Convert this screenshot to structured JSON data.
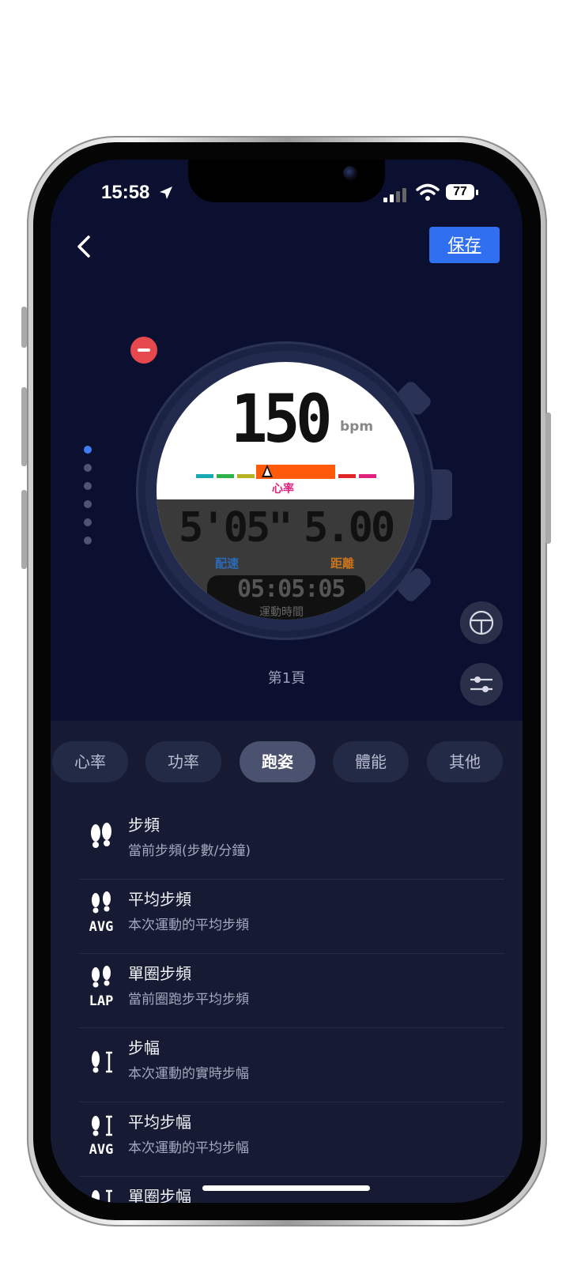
{
  "status_bar": {
    "time": "15:58",
    "battery": "77"
  },
  "header": {
    "save_label": "保存"
  },
  "watch": {
    "heart_rate": "150",
    "heart_rate_unit": "bpm",
    "heart_rate_label": "心率",
    "pace": "5'05\"",
    "pace_label": "配速",
    "distance": "5.00",
    "distance_label": "距離",
    "duration": "05:05:05",
    "duration_label": "運動時間",
    "zone_colors": [
      "#17a9b5",
      "#2bb34a",
      "#b6b223",
      "#ff5a0a",
      "#e02525",
      "#e4207d"
    ]
  },
  "page_indicator": {
    "count": 6,
    "active_index": 0
  },
  "page_label": "第1頁",
  "tabs": [
    {
      "label": "心率",
      "active": false
    },
    {
      "label": "功率",
      "active": false
    },
    {
      "label": "跑姿",
      "active": true
    },
    {
      "label": "體能",
      "active": false
    },
    {
      "label": "其他",
      "active": false
    }
  ],
  "metrics": [
    {
      "title": "步頻",
      "subtitle": "當前步頻(步數/分鐘)",
      "icon": "footsteps-icon",
      "badge": ""
    },
    {
      "title": "平均步頻",
      "subtitle": "本次運動的平均步頻",
      "icon": "footsteps-avg-icon",
      "badge": "AVG"
    },
    {
      "title": "單圈步頻",
      "subtitle": "當前圈跑步平均步頻",
      "icon": "footsteps-lap-icon",
      "badge": "LAP"
    },
    {
      "title": "步幅",
      "subtitle": "本次運動的實時步幅",
      "icon": "stride-icon",
      "badge": ""
    },
    {
      "title": "平均步幅",
      "subtitle": "本次運動的平均步幅",
      "icon": "stride-avg-icon",
      "badge": "AVG"
    },
    {
      "title": "單圈步幅",
      "subtitle": "",
      "icon": "stride-lap-icon",
      "badge": ""
    }
  ]
}
